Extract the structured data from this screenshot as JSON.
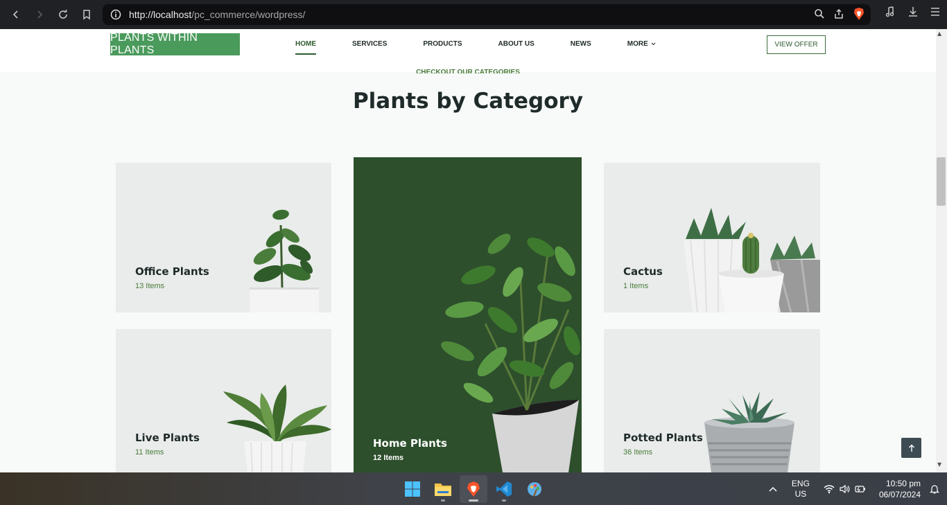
{
  "browser": {
    "url_host": "http://localhost",
    "url_path": "/pc_commerce/wordpress/"
  },
  "header": {
    "logo": "PLANTS WITHIN PLANTS",
    "nav": [
      "HOME",
      "SERVICES",
      "PRODUCTS",
      "ABOUT US",
      "NEWS",
      "MORE"
    ],
    "active_nav": "HOME",
    "cta": "VIEW OFFER"
  },
  "section": {
    "eyebrow": "CHECKOUT OUR CATEGORIES",
    "title": "Plants by Category"
  },
  "categories": [
    {
      "name": "Office Plants",
      "count": "13 Items"
    },
    {
      "name": "Cactus",
      "count": "1 Items"
    },
    {
      "name": "Live Plants",
      "count": "11 Items"
    },
    {
      "name": "Potted Plants",
      "count": "36 Items"
    },
    {
      "name": "Home Plants",
      "count": "12 Items",
      "featured": true
    }
  ],
  "taskbar": {
    "lang_line1": "ENG",
    "lang_line2": "US",
    "time": "10:50 pm",
    "date": "06/07/2024"
  },
  "colors": {
    "brand_green": "#4a9a5c",
    "dark_green": "#2d4f2c",
    "card_bg": "#e9ecea"
  }
}
